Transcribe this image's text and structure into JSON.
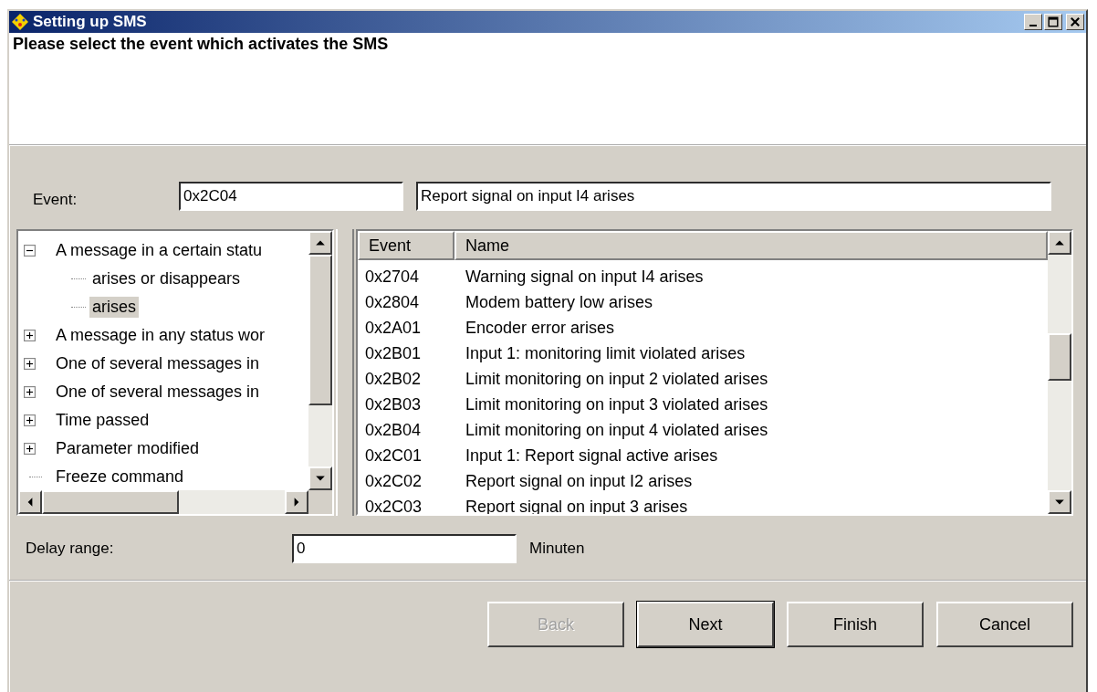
{
  "window": {
    "title": "Setting up SMS"
  },
  "header": {
    "instruction": "Please select the event which activates the SMS"
  },
  "event": {
    "label": "Event:",
    "code": "0x2C04",
    "description": "Report signal on input I4 arises"
  },
  "tree": {
    "items": [
      {
        "label": "A message in a certain statu",
        "kind": "node",
        "expanded": true,
        "children": [
          {
            "label": "arises or disappears",
            "selected": false
          },
          {
            "label": "arises",
            "selected": true
          }
        ]
      },
      {
        "label": "A message in any status wor",
        "kind": "node",
        "expanded": false
      },
      {
        "label": "One of several messages in",
        "kind": "node",
        "expanded": false
      },
      {
        "label": "One of several messages in",
        "kind": "node",
        "expanded": false
      },
      {
        "label": "Time passed",
        "kind": "node",
        "expanded": false
      },
      {
        "label": "Parameter modified",
        "kind": "node",
        "expanded": false
      },
      {
        "label": "Freeze command",
        "kind": "leaf"
      }
    ]
  },
  "table": {
    "columns": [
      "Event",
      "Name"
    ],
    "rows": [
      {
        "event": "0x2704",
        "name": "Warning signal on input I4 arises"
      },
      {
        "event": "0x2804",
        "name": "Modem battery low arises"
      },
      {
        "event": "0x2A01",
        "name": "Encoder error arises"
      },
      {
        "event": "0x2B01",
        "name": "Input 1: monitoring limit violated arises"
      },
      {
        "event": "0x2B02",
        "name": "Limit monitoring on input 2 violated arises"
      },
      {
        "event": "0x2B03",
        "name": "Limit monitoring on input 3 violated arises"
      },
      {
        "event": "0x2B04",
        "name": "Limit monitoring on input 4 violated arises"
      },
      {
        "event": "0x2C01",
        "name": "Input 1: Report signal active arises"
      },
      {
        "event": "0x2C02",
        "name": "Report signal on input I2 arises"
      },
      {
        "event": "0x2C03",
        "name": "Report signal on input 3 arises"
      }
    ]
  },
  "delay": {
    "label": "Delay range:",
    "value": "0",
    "unit": "Minuten"
  },
  "buttons": [
    {
      "label": "Back",
      "disabled": true,
      "focused": false
    },
    {
      "label": "Next",
      "disabled": false,
      "focused": true
    },
    {
      "label": "Finish",
      "disabled": false,
      "focused": false
    },
    {
      "label": "Cancel",
      "disabled": false,
      "focused": false
    }
  ]
}
